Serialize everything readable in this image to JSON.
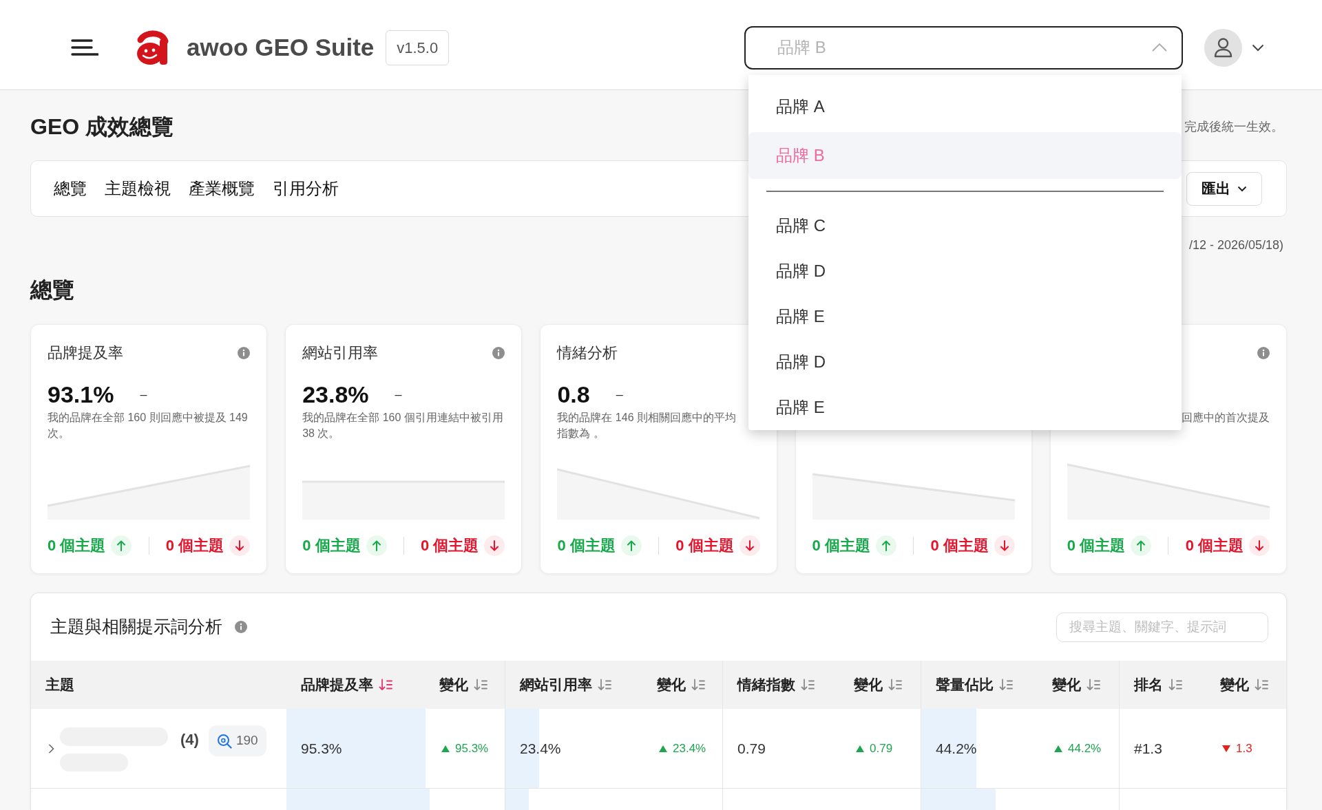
{
  "header": {
    "app_name": "awoo GEO Suite",
    "version": "v1.5.0",
    "brand_select": {
      "placeholder": "品牌 B",
      "expanded": true,
      "option_groups": [
        [
          {
            "label": "品牌 A",
            "selected": false
          },
          {
            "label": "品牌 B",
            "selected": true
          }
        ],
        [
          {
            "label": "品牌 C",
            "selected": false
          },
          {
            "label": "品牌 D",
            "selected": false
          },
          {
            "label": "品牌 E",
            "selected": false
          },
          {
            "label": "品牌 D",
            "selected": false
          },
          {
            "label": "品牌 E",
            "selected": false
          }
        ]
      ]
    }
  },
  "page": {
    "title": "GEO 成效總覽",
    "note": "完成後統一生效。",
    "tabs": [
      "總覽",
      "主題檢視",
      "產業概覽",
      "引用分析"
    ],
    "export_button": "匯出",
    "date_range": "/12 - 2026/05/18)",
    "section_title": "總覽",
    "cards": [
      {
        "title": "品牌提及率",
        "info": true,
        "value": "93.1%",
        "change": "–",
        "description": [
          "我的品牌在全部 160 則回應中被提及 149 次。"
        ],
        "sparkline": {
          "kind": "rise"
        },
        "rising_topics": "0 個主題",
        "falling_topics": "0 個主題"
      },
      {
        "title": "網站引用率",
        "info": true,
        "value": "23.8%",
        "change": "–",
        "description": [
          "我的品牌在全部 160 個引用連結中被引用 38 次。"
        ],
        "sparkline": {
          "kind": "flat"
        },
        "rising_topics": "0 個主題",
        "falling_topics": "0 個主題"
      },
      {
        "title": "情緒分析",
        "info": false,
        "value": "0.8",
        "change": "–",
        "description": [
          "我的品牌在 146 則相關回應中的平均",
          "指數為 。"
        ],
        "sparkline": {
          "kind": "steep"
        },
        "rising_topics": "0 個主題",
        "falling_topics": "0 個主題"
      },
      {
        "info": false,
        "sparkline": {
          "kind": "gentle"
        },
        "rising_topics": "0 個主題",
        "falling_topics": "0 個主題"
      },
      {
        "info": true,
        "description_end": "回應中的首次提及",
        "sparkline": {
          "kind": "fall"
        },
        "rising_topics": "0 個主題",
        "falling_topics": "0 個主題"
      }
    ]
  },
  "topics_table": {
    "title": "主題與相關提示詞分析",
    "search": {
      "placeholder": "搜尋主題、關鍵字、提示詞"
    },
    "columns": [
      {
        "label": "主題"
      },
      {
        "label": "品牌提及率",
        "sorted": true
      },
      {
        "label": "變化",
        "sorted": false
      },
      {
        "label": "網站引用率",
        "sorted": false
      },
      {
        "label": "變化",
        "sorted": false
      },
      {
        "label": "情緒指數",
        "sorted": false
      },
      {
        "label": "變化",
        "sorted": false
      },
      {
        "label": "聲量佔比",
        "sorted": false
      },
      {
        "label": "變化",
        "sorted": false
      },
      {
        "label": "排名",
        "sorted": false
      },
      {
        "label": "變化",
        "sorted": false
      }
    ],
    "rows": [
      {
        "cells": [
          {
            "kind": "topic",
            "expanded": false,
            "count": "(4)",
            "queries": "190"
          },
          {
            "kind": "metric",
            "text": "95.3%",
            "level": 0.953
          },
          {
            "kind": "change",
            "text": "95.3%",
            "rising": true
          },
          {
            "kind": "metric",
            "text": "23.4%",
            "level": 0.234
          },
          {
            "kind": "change",
            "text": "23.4%",
            "rising": true
          },
          {
            "kind": "metric",
            "text": "0.79"
          },
          {
            "kind": "change",
            "text": "0.79",
            "rising": true
          },
          {
            "kind": "metric",
            "text": "44.2%",
            "level": 0.442
          },
          {
            "kind": "change",
            "text": "44.2%",
            "rising": true
          },
          {
            "kind": "metric",
            "text": "#1.3"
          },
          {
            "kind": "change",
            "text": "1.3",
            "rising": false
          }
        ]
      },
      {
        "cells": [
          {
            "kind": "topic"
          },
          {
            "kind": "metric",
            "level": 0.98
          },
          {
            "kind": "change"
          },
          {
            "kind": "metric",
            "level": 0.16
          },
          {
            "kind": "change"
          },
          {
            "kind": "metric"
          },
          {
            "kind": "change"
          },
          {
            "kind": "metric",
            "level": 0.6
          },
          {
            "kind": "change"
          },
          {
            "kind": "metric"
          },
          {
            "kind": "change"
          }
        ]
      }
    ]
  }
}
